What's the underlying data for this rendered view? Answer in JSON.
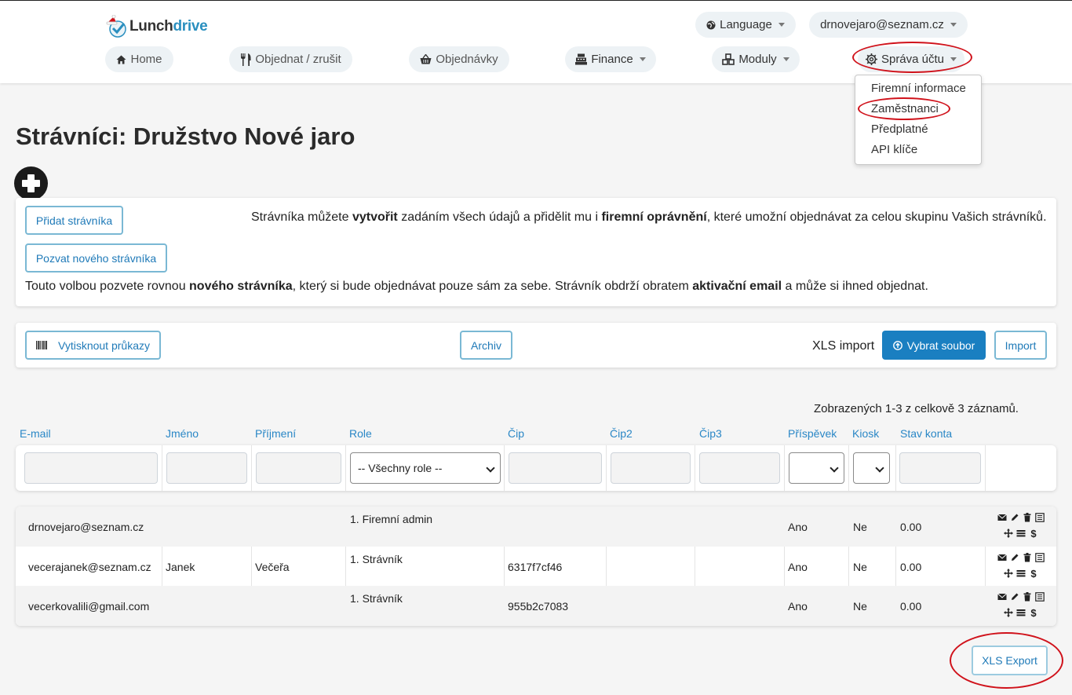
{
  "brand": {
    "part1": "Lunch",
    "part2": "drive"
  },
  "header": {
    "language": "Language",
    "account": "drnovejaro@seznam.cz"
  },
  "nav": {
    "home": "Home",
    "order": "Objednat / zrušit",
    "orders": "Objednávky",
    "finance": "Finance",
    "modules": "Moduly",
    "account_mgmt": "Správa účtu"
  },
  "dropdown": {
    "items": [
      "Firemní informace",
      "Zaměstnanci",
      "Předplatné",
      "API klíče"
    ]
  },
  "page": {
    "title": "Strávníci: Družstvo Nové jaro"
  },
  "info": {
    "add_button": "Přidat strávníka",
    "invite_button": "Pozvat nového strávníka",
    "create_p1": "Strávníka můžete ",
    "create_b1": "vytvořit",
    "create_p2": " zadáním všech údajů a přidělit mu i ",
    "create_b2": "firemní oprávnění",
    "create_p3": ", které umožní objednávat za celou skupinu Vašich strávníků.",
    "invite_p1": "Touto volbou pozvete rovnou ",
    "invite_b1": "nového strávníka",
    "invite_p2": ", který si bude objednávat pouze sám za sebe. Strávník obdrží obratem ",
    "invite_b2": "aktivační email",
    "invite_p3": " a může si ihned objednat."
  },
  "toolbar": {
    "print_cards": "Vytisknout průkazy",
    "archive": "Archiv",
    "xls_import_label": "XLS import",
    "choose_file": "Vybrat soubor",
    "import": "Import"
  },
  "table": {
    "summary": "Zobrazených 1-3 z celkově 3 záznamů.",
    "headers": [
      "E-mail",
      "Jméno",
      "Příjmení",
      "Role",
      "Čip",
      "Čip2",
      "Čip3",
      "Příspěvek",
      "Kiosk",
      "Stav konta"
    ],
    "role_filter": "-- Všechny role --",
    "rows": [
      {
        "email": "drnovejaro@seznam.cz",
        "first": "",
        "last": "",
        "role": "1. Firemní admin",
        "chip": "",
        "chip2": "",
        "chip3": "",
        "contribution": "Ano",
        "kiosk": "Ne",
        "balance": "0.00"
      },
      {
        "email": "vecerajanek@seznam.cz",
        "first": "Janek",
        "last": "Večeřa",
        "role": "1. Strávník",
        "chip": "6317f7cf46",
        "chip2": "",
        "chip3": "",
        "contribution": "Ano",
        "kiosk": "Ne",
        "balance": "0.00"
      },
      {
        "email": "vecerkovalili@gmail.com",
        "first": "",
        "last": "",
        "role": "1. Strávník",
        "chip": "955b2c7083",
        "chip2": "",
        "chip3": "",
        "contribution": "Ano",
        "kiosk": "Ne",
        "balance": "0.00"
      }
    ]
  },
  "export": {
    "xls_export": "XLS Export"
  },
  "colors": {
    "accent": "#1a7fc1",
    "link": "#2a87c6",
    "annotation": "#d0121b"
  }
}
